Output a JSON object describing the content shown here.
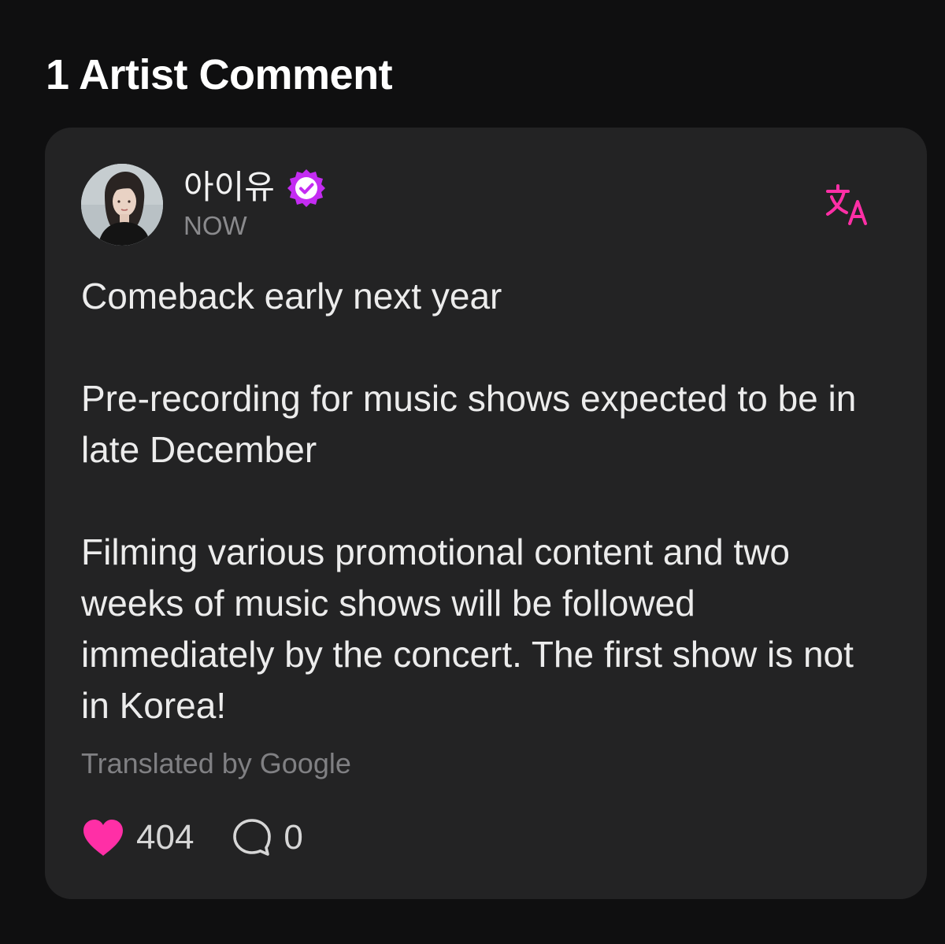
{
  "section": {
    "title": "1 Artist Comment"
  },
  "comment": {
    "author": {
      "name": "아이유",
      "verified": true,
      "avatar_icon": "avatar-photo"
    },
    "timestamp": "NOW",
    "translate_icon": "translate-icon",
    "paragraphs": [
      "Comeback early next year",
      "Pre-recording for music shows expected to be in late December",
      "Filming various promotional content and two weeks of music shows will be followed immediately by the concert. The first show is not in Korea!"
    ],
    "translated_by": "Translated by Google",
    "likes": "404",
    "replies": "0",
    "colors": {
      "accent": "#ff2fa6",
      "verified_badge": "#c42cf2",
      "card_background": "#232324",
      "page_background": "#0f0f10"
    }
  }
}
